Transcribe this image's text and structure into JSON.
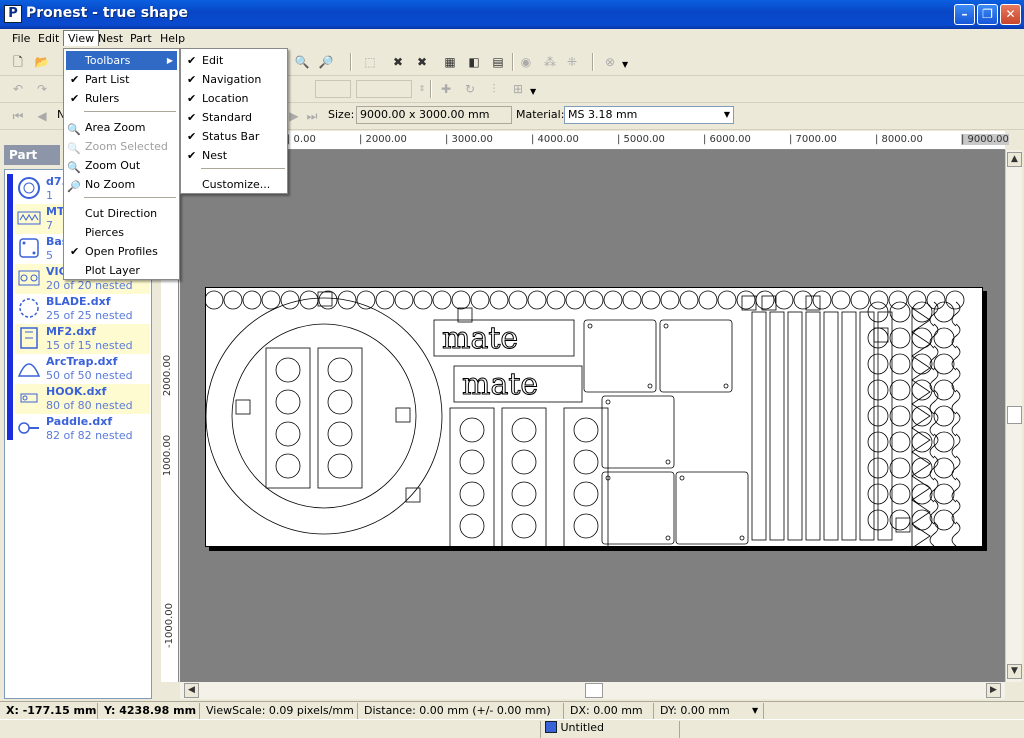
{
  "window": {
    "title": "Pronest - true shape",
    "app_icon": "P"
  },
  "menubar": {
    "items": [
      "File",
      "Edit",
      "View",
      "Nest",
      "Part",
      "Help"
    ]
  },
  "view_menu": {
    "items": [
      {
        "label": "Toolbars",
        "checked": false,
        "submenu": true
      },
      {
        "label": "Part List",
        "checked": true
      },
      {
        "label": "Rulers",
        "checked": true
      },
      {
        "label": "Area Zoom",
        "icon": "zoom-icon"
      },
      {
        "label": "Zoom Selected",
        "icon": "zoom-icon",
        "disabled": true
      },
      {
        "label": "Zoom Out",
        "icon": "zoom-out-icon"
      },
      {
        "label": "No Zoom",
        "icon": "no-zoom-icon"
      },
      {
        "label": "Cut Direction"
      },
      {
        "label": "Pierces"
      },
      {
        "label": "Open Profiles",
        "checked": true
      },
      {
        "label": "Plot Layer"
      }
    ]
  },
  "toolbars_submenu": {
    "items": [
      {
        "label": "Edit",
        "checked": true
      },
      {
        "label": "Navigation",
        "checked": true
      },
      {
        "label": "Location",
        "checked": true
      },
      {
        "label": "Standard",
        "checked": true
      },
      {
        "label": "Status Bar",
        "checked": true
      },
      {
        "label": "Nest",
        "checked": true
      },
      {
        "label": "Customize..."
      }
    ]
  },
  "nest_bar": {
    "size_label": "Size:",
    "size_value": "9000.00 x 3000.00 mm",
    "material_label": "Material:",
    "material_value": "MS 3.18 mm",
    "nest_letter": "N"
  },
  "part_list": {
    "header": "Part List",
    "items": [
      {
        "name": "d7.",
        "count": "1",
        "highlight": false,
        "thumb": "ring"
      },
      {
        "name": "MT",
        "count": "7",
        "highlight": true,
        "thumb": "text"
      },
      {
        "name": "Bas",
        "count": "5",
        "highlight": false,
        "thumb": "plate"
      },
      {
        "name": "VIC",
        "count": "20 of 20 nested",
        "highlight": true,
        "thumb": "circles"
      },
      {
        "name": "BLADE.dxf",
        "count": "25 of 25 nested",
        "highlight": false,
        "thumb": "blade"
      },
      {
        "name": "MF2.dxf",
        "count": "15 of 15 nested",
        "highlight": true,
        "thumb": "mf2"
      },
      {
        "name": "ArcTrap.dxf",
        "count": "50 of 50 nested",
        "highlight": false,
        "thumb": "arctrap"
      },
      {
        "name": "HOOK.dxf",
        "count": "80 of 80 nested",
        "highlight": true,
        "thumb": "hook"
      },
      {
        "name": "Paddle.dxf",
        "count": "82 of 82 nested",
        "highlight": false,
        "thumb": "paddle"
      }
    ]
  },
  "rulers": {
    "horizontal": [
      "0.00",
      "2000.00",
      "3000.00",
      "4000.00",
      "5000.00",
      "6000.00",
      "7000.00",
      "8000.00",
      "9000.00"
    ],
    "vertical": [
      "2000.00",
      "1000.00",
      "-1000.00"
    ]
  },
  "sheet": {
    "text_part": "mate"
  },
  "status": {
    "x": "X: -177.15 mm",
    "y": "Y: 4238.98 mm",
    "viewscale": "ViewScale: 0.09 pixels/mm",
    "distance": "Distance: 0.00 mm (+/- 0.00 mm)",
    "dx": "DX: 0.00 mm",
    "dy": "DY: 0.00 mm",
    "task": "Untitled"
  },
  "colors": {
    "titlebar": "#0a4ad0",
    "selection": "#316ac5",
    "canvas": "#808080",
    "part_link": "#3a62d8",
    "highlight": "#fffbd0"
  }
}
